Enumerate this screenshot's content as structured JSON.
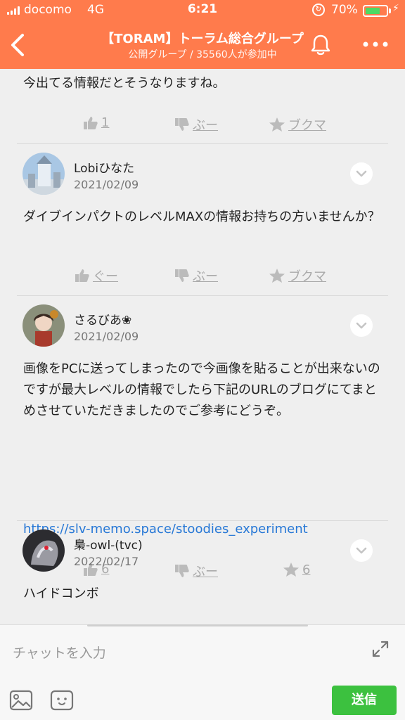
{
  "status_bar": {
    "carrier": "docomo",
    "network": "4G",
    "time": "6:21",
    "battery": "70%",
    "battery_level": 0.7
  },
  "header": {
    "title": "【TORAM】トーラム総合グループ",
    "subtitle": "公開グループ / 35560人が参加中",
    "accent_color": "#ff7b4c"
  },
  "posts": [
    {
      "text": "今出てる情報だとそうなりますね。",
      "reactions": {
        "like": "1",
        "boo": "ぶー",
        "bookmark": "ブクマ"
      }
    },
    {
      "username": "Lobiひなた",
      "date": "2021/02/09",
      "text": "ダイブインパクトのレベルMAXの情報お持ちの方いませんか？",
      "reactions": {
        "like": "ぐー",
        "boo": "ぶー",
        "bookmark": "ブクマ"
      }
    },
    {
      "username": "さるびあ❀",
      "date": "2021/02/09",
      "text": "画像をPCに送ってしまったので今画像を貼ることが出来ないのですが最大レベルの情報でしたら下記のURLのブログにてまとめさせていただきましたのでご参考にどうぞ。",
      "link": "https://slv-memo.space/stoodies_experiment",
      "reactions": {
        "like": "6",
        "boo": "ぶー",
        "bookmark": "6"
      }
    },
    {
      "username": "梟-owl-(tvc)",
      "date": "2022/02/17",
      "text": "ハイドコンボ"
    }
  ],
  "composer": {
    "placeholder": "チャットを入力",
    "send_label": "送信",
    "send_color": "#3cc13f"
  }
}
